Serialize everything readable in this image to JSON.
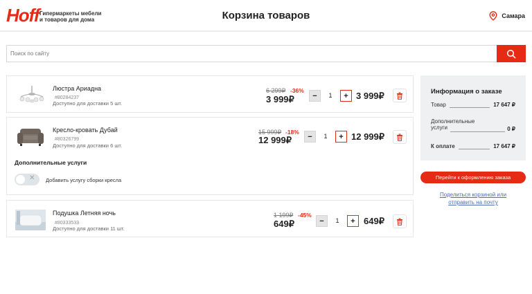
{
  "header": {
    "logo": "Hoff",
    "tagline_line1": "Гипермаркеты мебели",
    "tagline_line2": "и товаров для дома",
    "title": "Корзина товаров",
    "city": "Самара"
  },
  "search": {
    "placeholder": "Поиск по сайту"
  },
  "items": [
    {
      "name": "Люстра Ариадна",
      "sku": "#80284237",
      "availability": "Доступно для доставки 5 шт.",
      "old_price": "6 299₽",
      "discount": "-36%",
      "price": "3 999₽",
      "quantity": "1",
      "total": "3 999₽"
    },
    {
      "name": "Кресло-кровать Дубай",
      "sku": "#80326799",
      "availability": "Доступно для доставки 6 шт.",
      "old_price": "15 999₽",
      "discount": "-18%",
      "price": "12 999₽",
      "quantity": "1",
      "total": "12 999₽"
    },
    {
      "name": "Подушка Летняя ночь",
      "sku": "#80333533",
      "availability": "Доступно для доставки 11 шт.",
      "old_price": "1 199₽",
      "discount": "-45%",
      "price": "649₽",
      "quantity": "1",
      "total": "649₽"
    }
  ],
  "qty_controls": {
    "minus": "−",
    "plus": "+"
  },
  "extras": {
    "title": "Дополнительные услуги",
    "toggle_label": "Добавить услугу сборки кресла",
    "toggle_on": false
  },
  "summary": {
    "title": "Информация о заказе",
    "goods_label": "Товар",
    "goods_value": "17 647 ₽",
    "services_label_1": "Дополнительные",
    "services_label_2": "услуги",
    "services_value": "0 ₽",
    "total_label": "К оплате",
    "total_value": "17 647 ₽"
  },
  "checkout_button": "Перейти к оформлению заказа",
  "share_link_line1": "Поделиться корзиной или",
  "share_link_line2": "отправить на почту",
  "colors": {
    "brand": "#e52b14",
    "panel": "#eef0f2",
    "link": "#4a6fb5"
  }
}
